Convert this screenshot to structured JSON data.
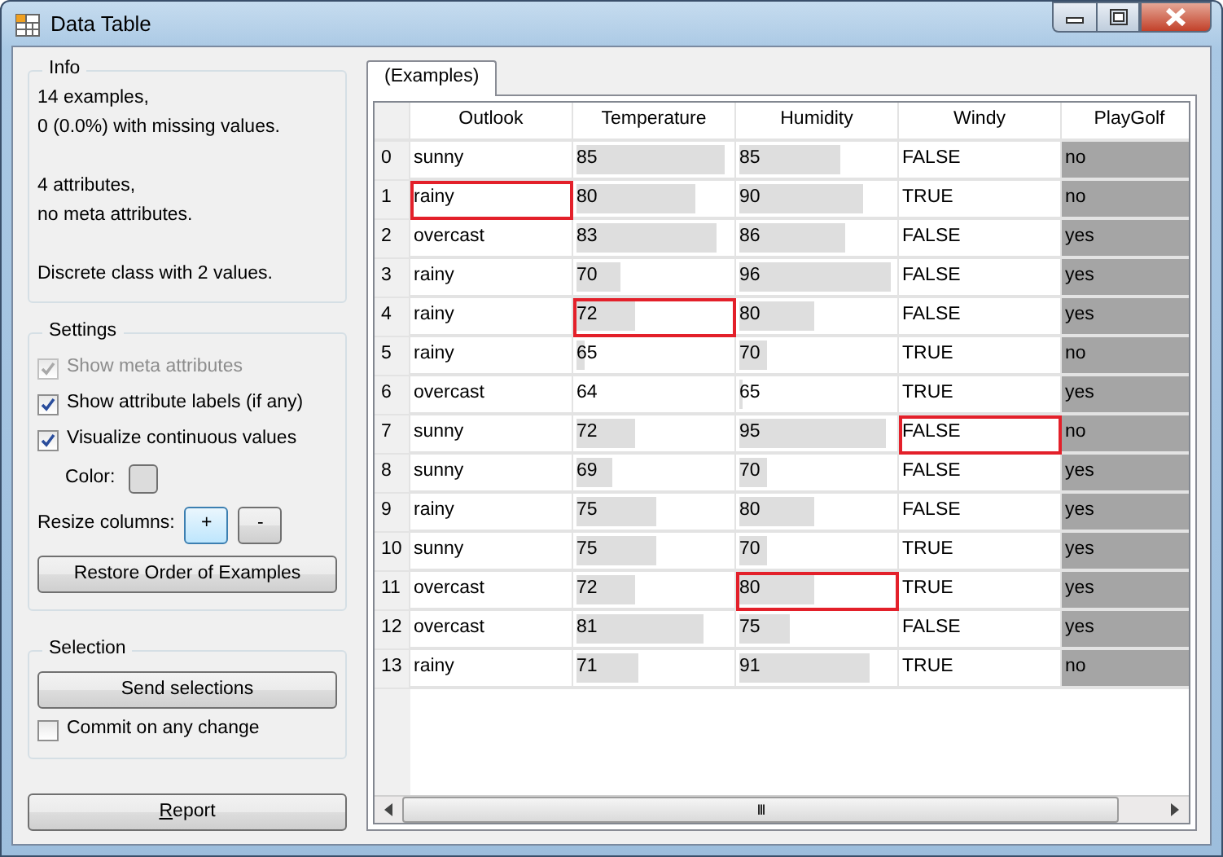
{
  "window": {
    "title": "Data Table"
  },
  "info": {
    "title": "Info",
    "paragraphs": [
      [
        "14 examples,",
        "0 (0.0%) with missing values."
      ],
      [
        "4 attributes,",
        "no meta attributes."
      ],
      [
        "Discrete class with 2 values."
      ]
    ]
  },
  "settings": {
    "title": "Settings",
    "checkboxes": [
      {
        "label": "Show meta attributes",
        "checked": true,
        "disabled": true
      },
      {
        "label": "Show attribute labels (if any)",
        "checked": true,
        "disabled": false
      },
      {
        "label": "Visualize continuous values",
        "checked": true,
        "disabled": false
      }
    ],
    "color_label": "Color:",
    "resize_label": "Resize columns:",
    "resize_buttons": [
      {
        "label": "+",
        "focused": true
      },
      {
        "label": "-",
        "focused": false
      }
    ],
    "restore_button": "Restore Order of Examples"
  },
  "selection": {
    "title": "Selection",
    "send_button": "Send selections",
    "commit": {
      "label": "Commit on any change",
      "checked": false
    }
  },
  "report_button": {
    "mnemonic": "R",
    "rest": "eport"
  },
  "tabs": [
    {
      "label": "(Examples)",
      "selected": true
    }
  ],
  "table": {
    "columns": [
      {
        "label": "Outlook",
        "kind": "discrete"
      },
      {
        "label": "Temperature",
        "kind": "continuous"
      },
      {
        "label": "Humidity",
        "kind": "continuous"
      },
      {
        "label": "Windy",
        "kind": "discrete"
      },
      {
        "label": "PlayGolf",
        "kind": "class"
      }
    ],
    "rows": [
      {
        "index": "0",
        "cells": [
          {
            "text": "sunny",
            "highlighted": false
          },
          {
            "text": "85",
            "level": 0.96,
            "highlighted": false
          },
          {
            "text": "85",
            "level": 0.65,
            "highlighted": false
          },
          {
            "text": "FALSE",
            "highlighted": false
          },
          {
            "text": "no",
            "highlighted": false
          }
        ]
      },
      {
        "index": "1",
        "cells": [
          {
            "text": "rainy",
            "highlighted": true
          },
          {
            "text": "80",
            "level": 0.77,
            "highlighted": false
          },
          {
            "text": "90",
            "level": 0.8,
            "highlighted": false
          },
          {
            "text": "TRUE",
            "highlighted": false
          },
          {
            "text": "no",
            "highlighted": false
          }
        ]
      },
      {
        "index": "2",
        "cells": [
          {
            "text": "overcast",
            "highlighted": false
          },
          {
            "text": "83",
            "level": 0.9,
            "highlighted": false
          },
          {
            "text": "86",
            "level": 0.68,
            "highlighted": false
          },
          {
            "text": "FALSE",
            "highlighted": false
          },
          {
            "text": "yes",
            "highlighted": false
          }
        ]
      },
      {
        "index": "3",
        "cells": [
          {
            "text": "rainy",
            "highlighted": false
          },
          {
            "text": "70",
            "level": 0.28,
            "highlighted": false
          },
          {
            "text": "96",
            "level": 0.98,
            "highlighted": false
          },
          {
            "text": "FALSE",
            "highlighted": false
          },
          {
            "text": "yes",
            "highlighted": false
          }
        ]
      },
      {
        "index": "4",
        "cells": [
          {
            "text": "rainy",
            "highlighted": false
          },
          {
            "text": "72",
            "level": 0.38,
            "highlighted": true
          },
          {
            "text": "80",
            "level": 0.48,
            "highlighted": false
          },
          {
            "text": "FALSE",
            "highlighted": false
          },
          {
            "text": "yes",
            "highlighted": false
          }
        ]
      },
      {
        "index": "5",
        "cells": [
          {
            "text": "rainy",
            "highlighted": false
          },
          {
            "text": "65",
            "level": 0.05,
            "highlighted": false
          },
          {
            "text": "70",
            "level": 0.18,
            "highlighted": false
          },
          {
            "text": "TRUE",
            "highlighted": false
          },
          {
            "text": "no",
            "highlighted": false
          }
        ]
      },
      {
        "index": "6",
        "cells": [
          {
            "text": "overcast",
            "highlighted": false
          },
          {
            "text": "64",
            "level": 0.0,
            "highlighted": false
          },
          {
            "text": "65",
            "level": 0.02,
            "highlighted": false
          },
          {
            "text": "TRUE",
            "highlighted": false
          },
          {
            "text": "yes",
            "highlighted": false
          }
        ]
      },
      {
        "index": "7",
        "cells": [
          {
            "text": "sunny",
            "highlighted": false
          },
          {
            "text": "72",
            "level": 0.38,
            "highlighted": false
          },
          {
            "text": "95",
            "level": 0.95,
            "highlighted": false
          },
          {
            "text": "FALSE",
            "highlighted": true
          },
          {
            "text": "no",
            "highlighted": false
          }
        ]
      },
      {
        "index": "8",
        "cells": [
          {
            "text": "sunny",
            "highlighted": false
          },
          {
            "text": "69",
            "level": 0.23,
            "highlighted": false
          },
          {
            "text": "70",
            "level": 0.18,
            "highlighted": false
          },
          {
            "text": "FALSE",
            "highlighted": false
          },
          {
            "text": "yes",
            "highlighted": false
          }
        ]
      },
      {
        "index": "9",
        "cells": [
          {
            "text": "rainy",
            "highlighted": false
          },
          {
            "text": "75",
            "level": 0.52,
            "highlighted": false
          },
          {
            "text": "80",
            "level": 0.48,
            "highlighted": false
          },
          {
            "text": "FALSE",
            "highlighted": false
          },
          {
            "text": "yes",
            "highlighted": false
          }
        ]
      },
      {
        "index": "10",
        "cells": [
          {
            "text": "sunny",
            "highlighted": false
          },
          {
            "text": "75",
            "level": 0.52,
            "highlighted": false
          },
          {
            "text": "70",
            "level": 0.18,
            "highlighted": false
          },
          {
            "text": "TRUE",
            "highlighted": false
          },
          {
            "text": "yes",
            "highlighted": false
          }
        ]
      },
      {
        "index": "11",
        "cells": [
          {
            "text": "overcast",
            "highlighted": false
          },
          {
            "text": "72",
            "level": 0.38,
            "highlighted": false
          },
          {
            "text": "80",
            "level": 0.48,
            "highlighted": true
          },
          {
            "text": "TRUE",
            "highlighted": false
          },
          {
            "text": "yes",
            "highlighted": false
          }
        ]
      },
      {
        "index": "12",
        "cells": [
          {
            "text": "overcast",
            "highlighted": false
          },
          {
            "text": "81",
            "level": 0.82,
            "highlighted": false
          },
          {
            "text": "75",
            "level": 0.33,
            "highlighted": false
          },
          {
            "text": "FALSE",
            "highlighted": false
          },
          {
            "text": "yes",
            "highlighted": false
          }
        ]
      },
      {
        "index": "13",
        "cells": [
          {
            "text": "rainy",
            "highlighted": false
          },
          {
            "text": "71",
            "level": 0.4,
            "highlighted": false
          },
          {
            "text": "91",
            "level": 0.84,
            "highlighted": false
          },
          {
            "text": "TRUE",
            "highlighted": false
          },
          {
            "text": "no",
            "highlighted": false
          }
        ]
      }
    ]
  },
  "scroll_thumb": "III"
}
